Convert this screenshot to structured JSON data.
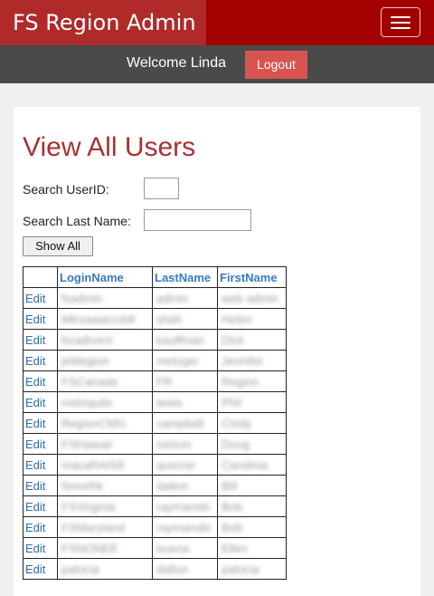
{
  "navbar": {
    "brand": "FS Region Admin",
    "menu_icon": "hamburger-icon",
    "brand_color": "#b02a2a",
    "bar_color": "#a30000"
  },
  "welcome": {
    "text": "Welcome Linda",
    "logout_label": "Logout",
    "logout_color": "#d9534f"
  },
  "page": {
    "title": "View All Users",
    "title_color": "#a83232"
  },
  "search": {
    "userid_label": "Search UserID:",
    "userid_value": "",
    "lastname_label": "Search Last Name:",
    "lastname_value": "",
    "show_all_label": "Show All"
  },
  "table": {
    "headers": [
      "",
      "LoginName",
      "LastName",
      "FirstName"
    ],
    "edit_label": "Edit",
    "rows": [
      {
        "login": "fsadmin",
        "last": "admin",
        "first": "web admin"
      },
      {
        "login": "MKsawarzcb8",
        "last": "shah",
        "first": "Helen"
      },
      {
        "login": "fsradivent",
        "last": "kauffman",
        "first": "Dick"
      },
      {
        "login": "jeMegion",
        "last": "metzger",
        "first": "Jennifer"
      },
      {
        "login": "FSCanada",
        "last": "FR",
        "first": "Region"
      },
      {
        "login": "meloquite",
        "last": "lewis",
        "first": "Phil"
      },
      {
        "login": "RegionCMG",
        "last": "campbell",
        "first": "Cindy"
      },
      {
        "login": "FSHawaii",
        "last": "nelson",
        "first": "Doug"
      },
      {
        "login": "macaRAIS9",
        "last": "quercei",
        "first": "Carolinia"
      },
      {
        "login": "fsnorthk",
        "last": "dalton",
        "first": "Bill"
      },
      {
        "login": "FSVirginia",
        "last": "raymanski",
        "first": "Bob"
      },
      {
        "login": "FSMaryland",
        "last": "raymanski",
        "first": "Bob"
      },
      {
        "login": "FSNONEE",
        "last": "buena",
        "first": "Ellen"
      },
      {
        "login": "patricia",
        "last": "dalton",
        "first": "patricia"
      }
    ]
  }
}
